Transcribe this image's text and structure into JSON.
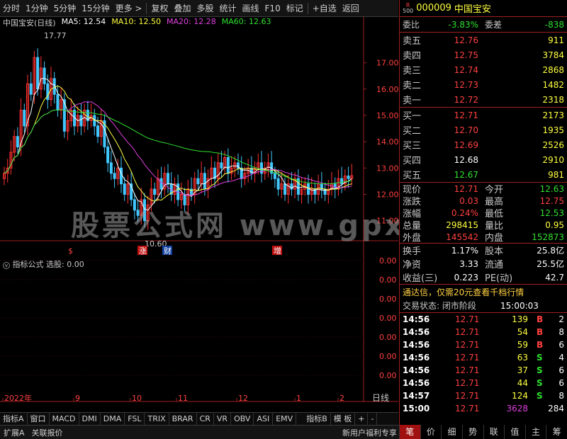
{
  "toolbar": {
    "items": [
      "分时",
      "1分钟",
      "5分钟",
      "15分钟",
      "更多 >",
      "复权",
      "叠加",
      "多股",
      "统计",
      "画线",
      "F10",
      "标记",
      "+自选",
      "返回"
    ]
  },
  "legend": {
    "name": "中国宝安(日线)",
    "ma5": "MA5: 12.54",
    "ma10": "MA10: 12.50",
    "ma20": "MA20: 12.28",
    "ma60": "MA60: 12.63",
    "high_label": "17.77",
    "low_label": "10.60"
  },
  "colors": {
    "ma5": "#ffffff",
    "ma10": "#ffff40",
    "ma20": "#e040e0",
    "ma60": "#30e030",
    "up": "#ff3030",
    "down": "#40c8ff"
  },
  "price_axis": [
    "17.00",
    "16.00",
    "15.00",
    "14.00",
    "13.00",
    "12.00",
    "11.00"
  ],
  "indicator": {
    "label": "指标公式",
    "value": "选股: 0.00",
    "axis": [
      "0.00",
      "0.00",
      "0.00",
      "0.00",
      "0.00",
      "0.00",
      "0.00"
    ]
  },
  "time_axis": [
    "2022年",
    "9",
    "10",
    "11",
    "12",
    "1",
    "2"
  ],
  "period_label": "日线",
  "event_markers": [
    "$",
    "涨",
    "财",
    "增"
  ],
  "bottom_tabs": [
    "指标A",
    "窗口",
    "MACD",
    "DMI",
    "DMA",
    "FSL",
    "TRIX",
    "BRAR",
    "CR",
    "VR",
    "OBV",
    "ASI",
    "EMV",
    "指标B",
    "模 板",
    "+",
    "-"
  ],
  "status_bar": {
    "expand": "扩展A",
    "related": "关联报价",
    "promo": "新用户福利专享"
  },
  "quote": {
    "sub_r": "R",
    "sub_num": "500",
    "code": "000009",
    "name": "中国宝安",
    "weibi_label": "委比",
    "weibi": "-3.83%",
    "weicha_label": "委差",
    "weicha": "-838",
    "asks": [
      {
        "label": "卖五",
        "price": "12.76",
        "vol": "911"
      },
      {
        "label": "卖四",
        "price": "12.75",
        "vol": "3784"
      },
      {
        "label": "卖三",
        "price": "12.74",
        "vol": "2868"
      },
      {
        "label": "卖二",
        "price": "12.73",
        "vol": "1482"
      },
      {
        "label": "卖一",
        "price": "12.72",
        "vol": "2318"
      }
    ],
    "bids": [
      {
        "label": "买一",
        "price": "12.71",
        "vol": "2173"
      },
      {
        "label": "买二",
        "price": "12.70",
        "vol": "1935"
      },
      {
        "label": "买三",
        "price": "12.69",
        "vol": "2526"
      },
      {
        "label": "买四",
        "price": "12.68",
        "vol": "2910"
      },
      {
        "label": "买五",
        "price": "12.67",
        "vol": "981"
      }
    ],
    "stats": [
      {
        "l1": "现价",
        "v1": "12.71",
        "c1": "red",
        "l2": "今开",
        "v2": "12.63",
        "c2": "green"
      },
      {
        "l1": "涨跌",
        "v1": "0.03",
        "c1": "red",
        "l2": "最高",
        "v2": "12.75",
        "c2": "red"
      },
      {
        "l1": "涨幅",
        "v1": "0.24%",
        "c1": "red",
        "l2": "最低",
        "v2": "12.53",
        "c2": "green"
      },
      {
        "l1": "总量",
        "v1": "298415",
        "c1": "yellow",
        "l2": "量比",
        "v2": "0.95",
        "c2": "yellow"
      },
      {
        "l1": "外盘",
        "v1": "145542",
        "c1": "red",
        "l2": "内盘",
        "v2": "152873",
        "c2": "green"
      }
    ],
    "stats2": [
      {
        "l1": "换手",
        "v1": "1.17%",
        "l2": "股本",
        "v2": "25.8亿"
      },
      {
        "l1": "净资",
        "v1": "3.33",
        "l2": "流通",
        "v2": "25.5亿"
      },
      {
        "l1": "收益(三)",
        "v1": "0.223",
        "l2": "PE(动)",
        "v2": "42.7"
      }
    ],
    "promo": "通达信，仅需20元查看千档行情",
    "trade_state_label": "交易状态: 闭市阶段",
    "trade_state_time": "15:00:03",
    "ticks": [
      {
        "t": "14:56",
        "p": "12.71",
        "v": "139",
        "bs": "B",
        "n": "2"
      },
      {
        "t": "14:56",
        "p": "12.71",
        "v": "54",
        "bs": "B",
        "n": "8"
      },
      {
        "t": "14:56",
        "p": "12.71",
        "v": "59",
        "bs": "B",
        "n": "6"
      },
      {
        "t": "14:56",
        "p": "12.71",
        "v": "63",
        "bs": "S",
        "n": "4"
      },
      {
        "t": "14:56",
        "p": "12.71",
        "v": "37",
        "bs": "S",
        "n": "6"
      },
      {
        "t": "14:56",
        "p": "12.71",
        "v": "44",
        "bs": "S",
        "n": "6"
      },
      {
        "t": "14:57",
        "p": "12.71",
        "v": "124",
        "bs": "S",
        "n": "8"
      },
      {
        "t": "15:00",
        "p": "12.71",
        "v": "3628",
        "bs": "",
        "n": "284"
      }
    ],
    "tabs": [
      "笔",
      "价",
      "细",
      "势",
      "联",
      "值",
      "主",
      "筹"
    ]
  },
  "watermark": "股票公式网 www.gpxs.com"
}
